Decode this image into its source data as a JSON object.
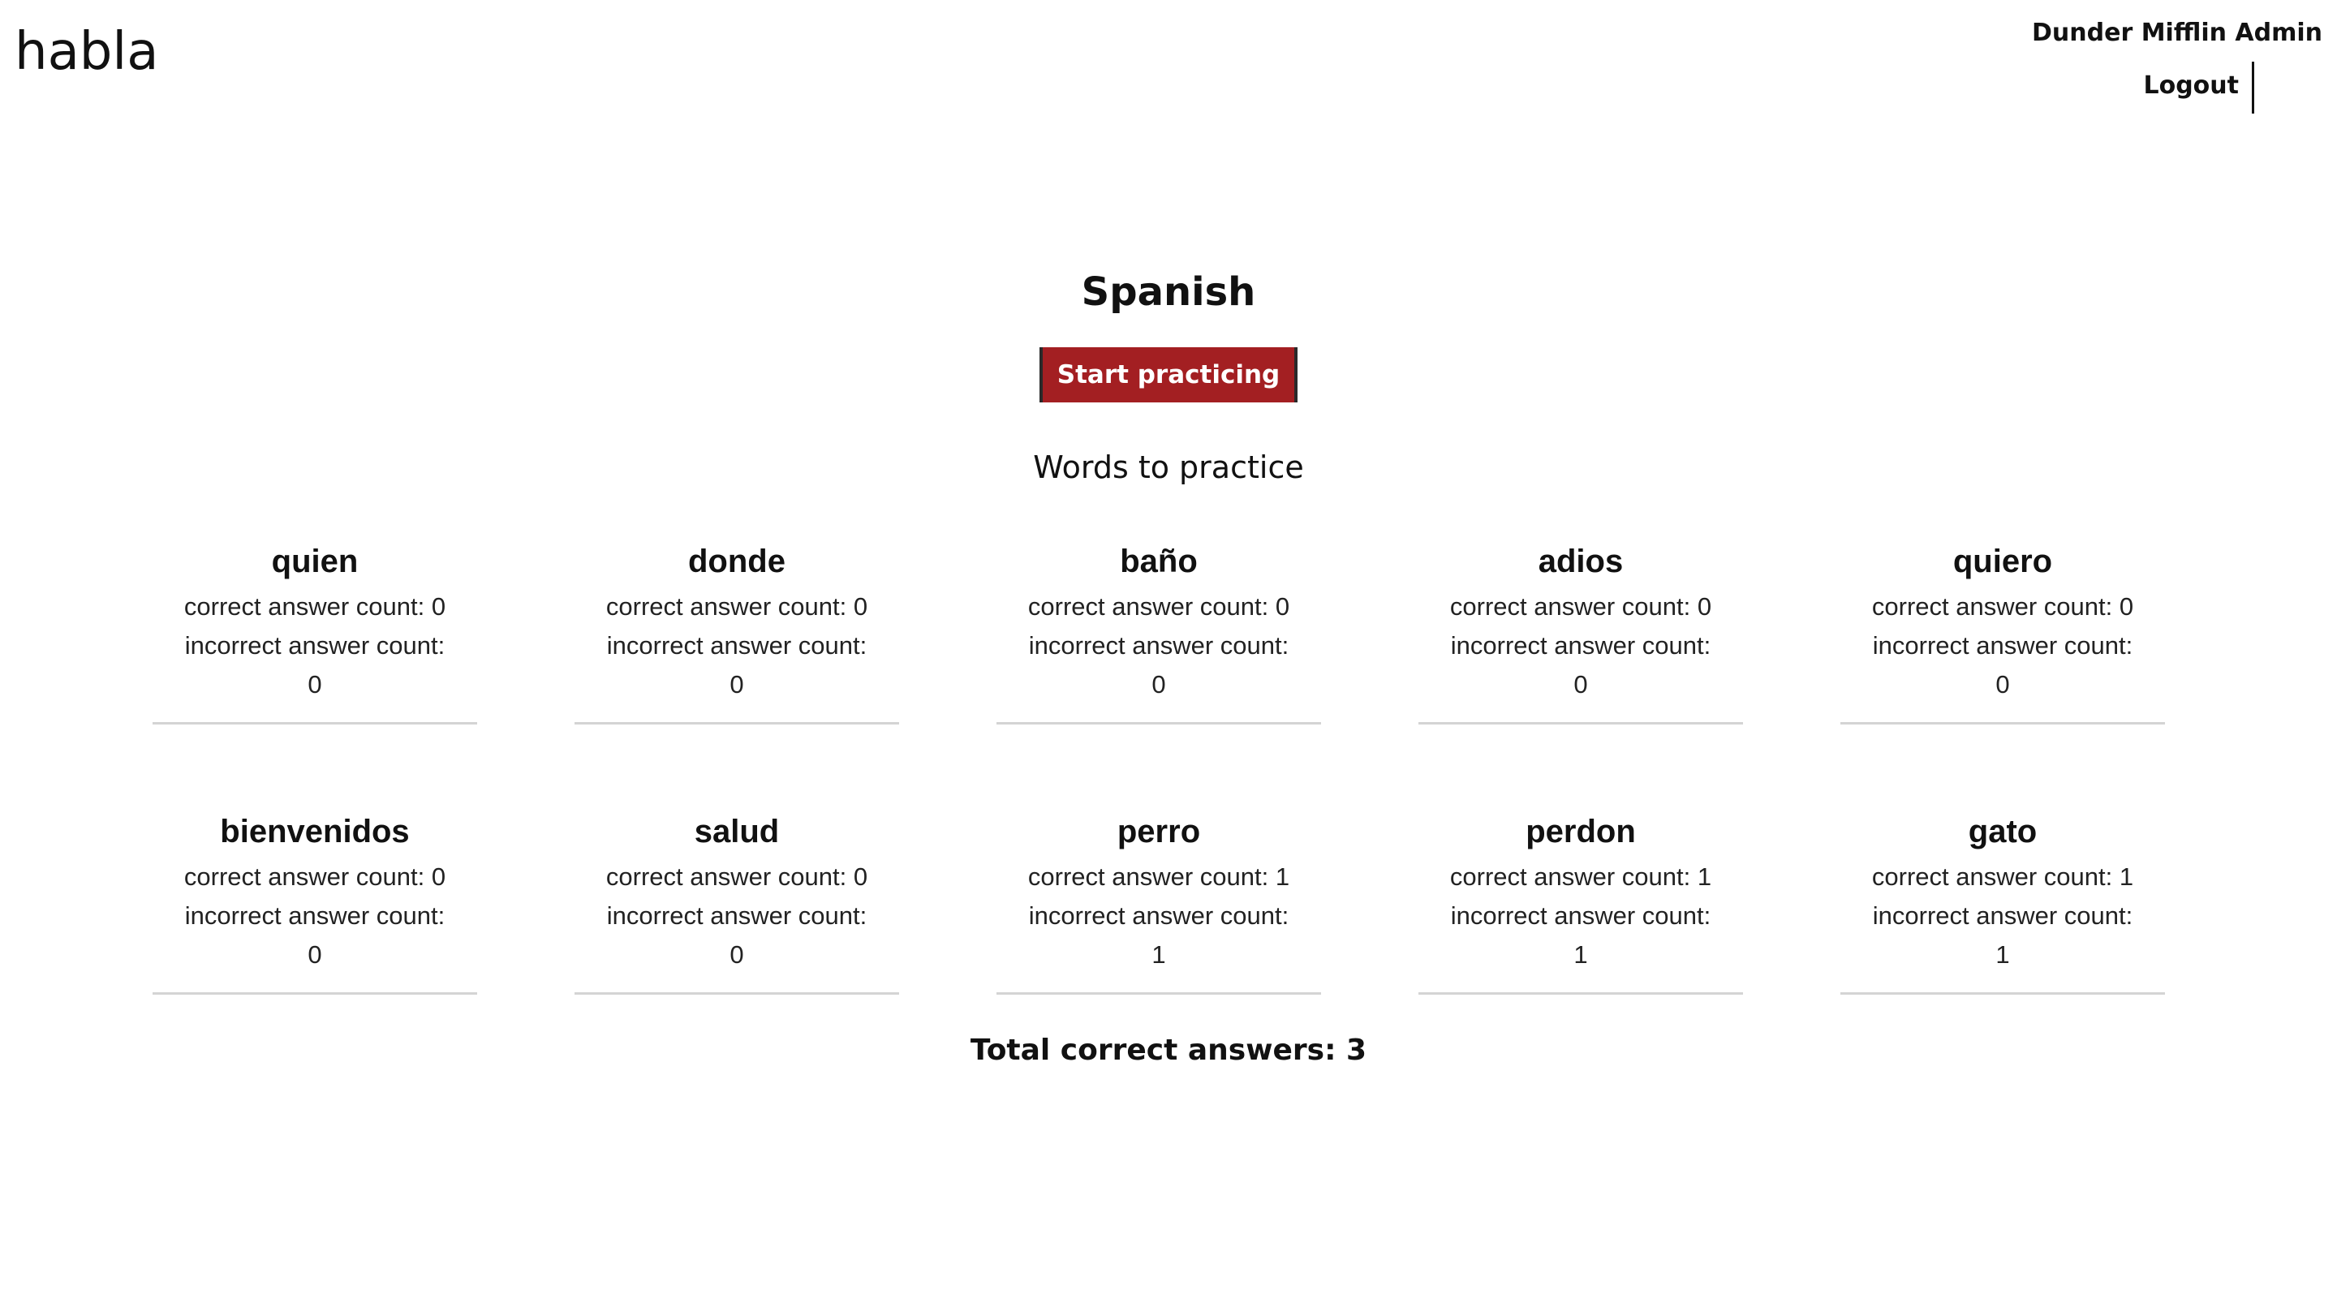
{
  "header": {
    "brand": "habla",
    "account_name": "Dunder Mifflin Admin",
    "logout_label": "Logout"
  },
  "main": {
    "language_title": "Spanish",
    "start_button_label": "Start practicing",
    "section_heading": "Words to practice",
    "words": [
      {
        "word": "quien",
        "correct_label": "correct answer count: 0",
        "incorrect_label": "incorrect answer count:",
        "incorrect_value": "0"
      },
      {
        "word": "donde",
        "correct_label": "correct answer count: 0",
        "incorrect_label": "incorrect answer count:",
        "incorrect_value": "0"
      },
      {
        "word": "baño",
        "correct_label": "correct answer count: 0",
        "incorrect_label": "incorrect answer count:",
        "incorrect_value": "0"
      },
      {
        "word": "adios",
        "correct_label": "correct answer count: 0",
        "incorrect_label": "incorrect answer count:",
        "incorrect_value": "0"
      },
      {
        "word": "quiero",
        "correct_label": "correct answer count: 0",
        "incorrect_label": "incorrect answer count:",
        "incorrect_value": "0"
      },
      {
        "word": "bienvenidos",
        "correct_label": "correct answer count: 0",
        "incorrect_label": "incorrect answer count:",
        "incorrect_value": "0"
      },
      {
        "word": "salud",
        "correct_label": "correct answer count: 0",
        "incorrect_label": "incorrect answer count:",
        "incorrect_value": "0"
      },
      {
        "word": "perro",
        "correct_label": "correct answer count: 1",
        "incorrect_label": "incorrect answer count:",
        "incorrect_value": "1"
      },
      {
        "word": "perdon",
        "correct_label": "correct answer count: 1",
        "incorrect_label": "incorrect answer count:",
        "incorrect_value": "1"
      },
      {
        "word": "gato",
        "correct_label": "correct answer count: 1",
        "incorrect_label": "incorrect answer count:",
        "incorrect_value": "1"
      }
    ],
    "total_label": "Total correct answers: 3"
  },
  "colors": {
    "accent": "#a31f22",
    "text": "#111111",
    "divider": "#d4d4d4"
  }
}
